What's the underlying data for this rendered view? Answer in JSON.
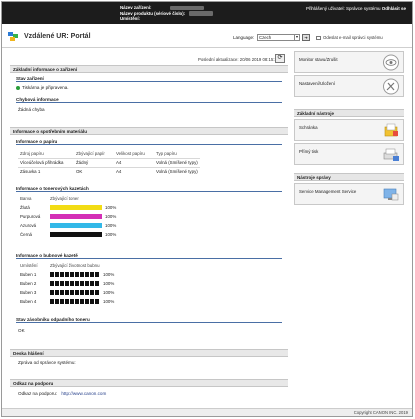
{
  "header": {
    "device_name_label": "Název zařízení:",
    "product_name_label": "Název produktu (sériové číslo):",
    "location_label": "Umístění:",
    "user_info": "Přihlášený uživatel: Správce systému",
    "logout_label": "Odhlásit se"
  },
  "portal": {
    "title": "Vzdálené UR: Portál",
    "language_label": "Language:",
    "language_value": "Czech",
    "mail_link": "Odeslat e-mail správci systému"
  },
  "status": {
    "last_updated": "Poslední aktualizace: 20/06 2019 08:15:21"
  },
  "basic_info": {
    "title": "Základní informace o zařízení",
    "device_state_title": "Stav zařízení",
    "device_state_text": "Tiskárna je připravena.",
    "error_info_title": "Chybová informace",
    "error_info_text": "Žádná chyba"
  },
  "consumables": {
    "title": "Informace o spotřebním materiálu",
    "paper": {
      "title": "Informace o papíru",
      "headers": [
        "Zdroj papíru",
        "Zbývající papír",
        "Velikost papíru",
        "Typ papíru"
      ],
      "rows": [
        [
          "Víceúčelová přihrádka",
          "Žádný",
          "A4",
          "Volná (Smíšené typy)"
        ],
        [
          "Zásuvka 1",
          "OK",
          "A4",
          "Volná (Smíšené typy)"
        ]
      ]
    },
    "toner": {
      "title": "Informace o tonerových kazetách",
      "headers": [
        "Barva",
        "Zbývající toner"
      ],
      "rows": [
        {
          "name": "Žlutá",
          "level": "100%",
          "color": "#f2dc14"
        },
        {
          "name": "Purpurová",
          "level": "100%",
          "color": "#d42fb6"
        },
        {
          "name": "Azurová",
          "level": "100%",
          "color": "#32b8e8"
        },
        {
          "name": "Černá",
          "level": "100%",
          "color": "#111111"
        }
      ]
    },
    "drum": {
      "title": "Informace o bubnové kazetě",
      "headers": [
        "Umístění",
        "Zbývající životnost bubnu"
      ],
      "rows": [
        {
          "name": "Buben 1",
          "level": "100%"
        },
        {
          "name": "Buben 2",
          "level": "100%"
        },
        {
          "name": "Buben 3",
          "level": "100%"
        },
        {
          "name": "Buben 4",
          "level": "100%"
        }
      ]
    },
    "waste": {
      "title": "Stav zásobníku odpadního toneru",
      "value": "OK"
    }
  },
  "board": {
    "title": "Deska hlášení",
    "text": "Zpráva od správce systému:"
  },
  "support": {
    "title": "Odkaz na podporu",
    "label": "Odkaz na podporu:",
    "url": "http://www.canon.com"
  },
  "right_panel": {
    "monitor": "Monitor stavu/Zrušit",
    "settings": "Nastavení/Uložení",
    "basic_tools_title": "Základní nástroje",
    "mailbox": "Schránka",
    "direct_print": "Přímý tisk",
    "admin_tools_title": "Nástroje správy",
    "service_mgmt": "Service Management Service"
  },
  "footer": {
    "copyright": "Copyright CANON INC. 2019"
  }
}
